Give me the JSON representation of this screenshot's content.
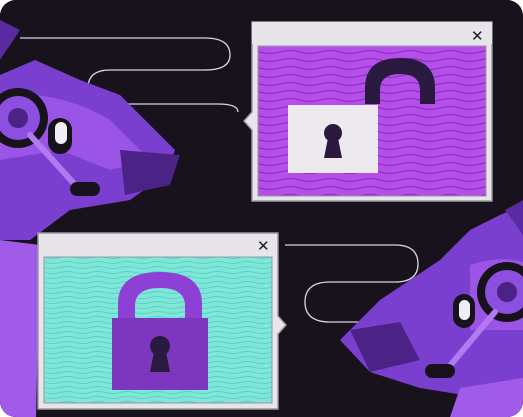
{
  "top_window": {
    "close_label": "✕",
    "icon": "unlocked-padlock-icon",
    "background_color": "#b44ce6"
  },
  "bottom_window": {
    "close_label": "✕",
    "icon": "locked-padlock-icon",
    "background_color": "#7fe7da"
  },
  "colors": {
    "backdrop": "#17121c",
    "window_chrome": "#e7e5ea",
    "purple_dark": "#4b2387",
    "purple_mid": "#7b3fd0",
    "purple_light": "#a863ee"
  },
  "decorations": [
    "left-dog-headset-icon",
    "right-dog-headset-icon",
    "cable-line"
  ]
}
